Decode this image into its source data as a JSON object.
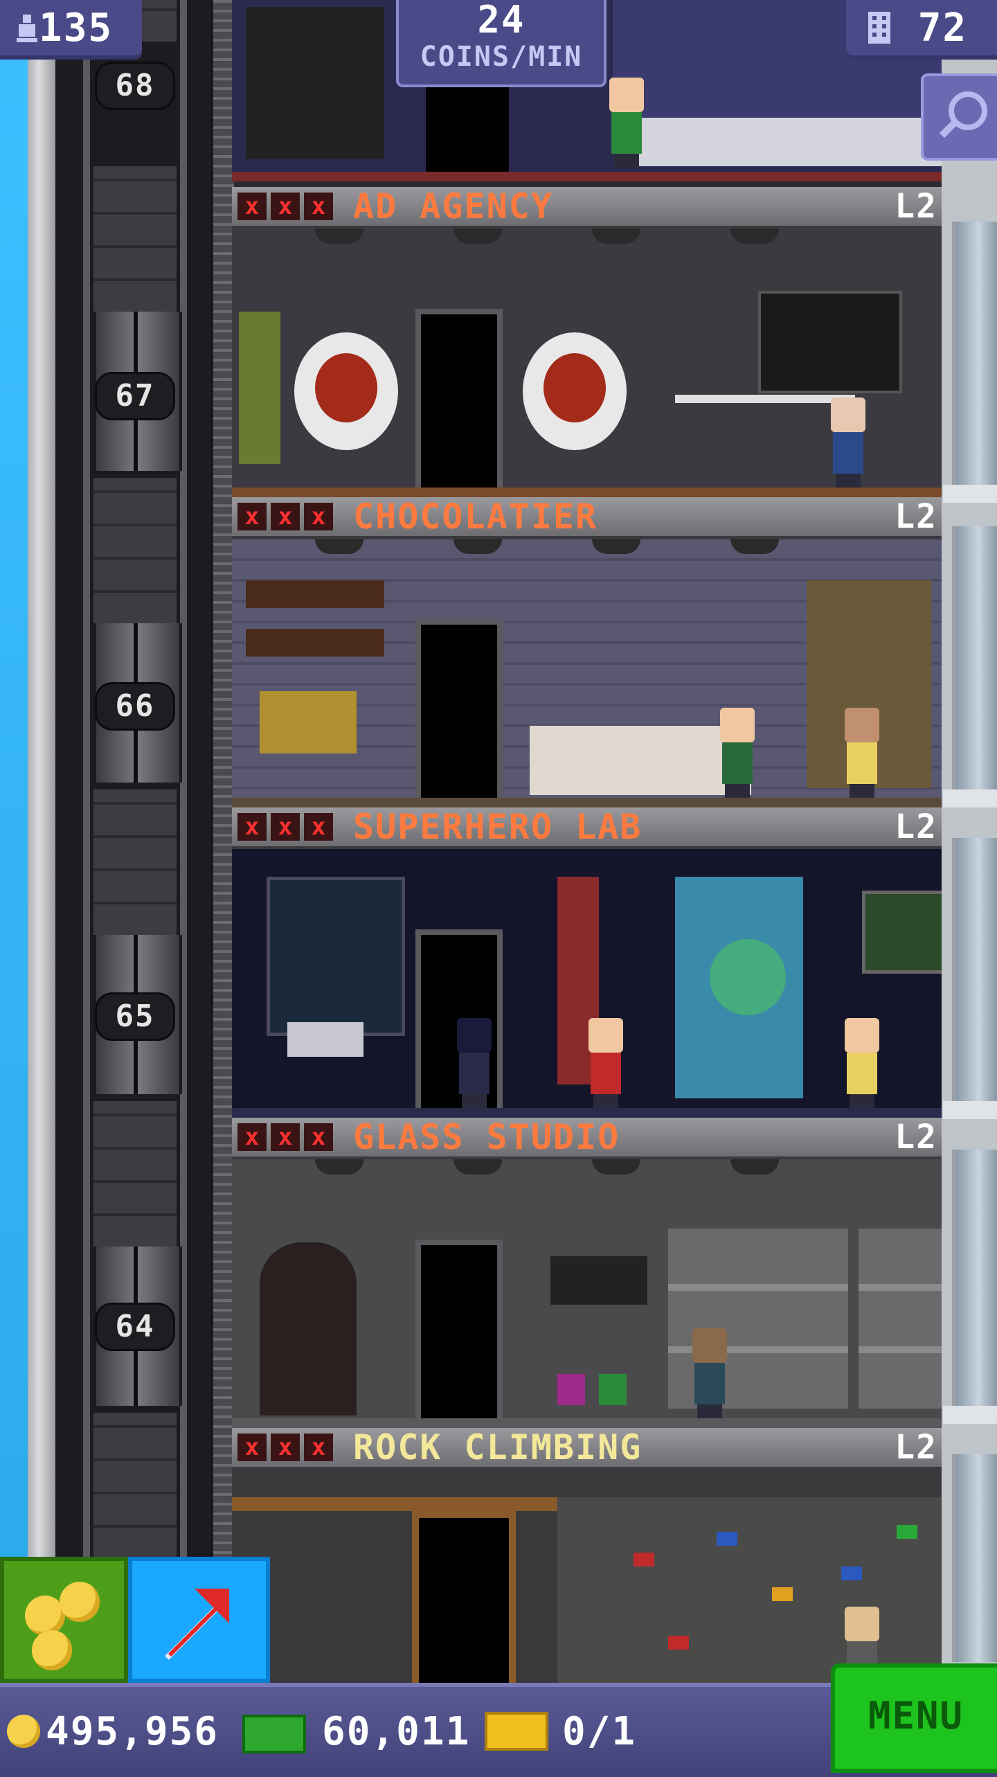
{
  "hud": {
    "population": "135",
    "coins_per_min_value": "24",
    "coins_per_min_label": "COINS/MIN",
    "floors": "72"
  },
  "shaft": {
    "floor_numbers": [
      "68",
      "67",
      "66",
      "65",
      "64"
    ]
  },
  "floors": [
    {
      "name": "AD AGENCY",
      "level": "L2",
      "marks": [
        "x",
        "x",
        "x"
      ]
    },
    {
      "name": "CHOCOLATIER",
      "level": "L2",
      "marks": [
        "x",
        "x",
        "x"
      ]
    },
    {
      "name": "SUPERHERO LAB",
      "level": "L2",
      "marks": [
        "x",
        "x",
        "x"
      ]
    },
    {
      "name": "GLASS STUDIO",
      "level": "L2",
      "marks": [
        "x",
        "x",
        "x"
      ]
    },
    {
      "name": "ROCK CLIMBING",
      "level": "L2",
      "marks": [
        "x",
        "x",
        "x"
      ]
    }
  ],
  "bottom": {
    "coins": "495,956",
    "bux": "60,011",
    "tickets": "0/1",
    "menu_label": "MENU"
  },
  "colors": {
    "floor_name_orange": "#ff7a3e",
    "floor_name_gold": "#f3e79a",
    "hud_purple": "#4a4a88",
    "menu_green": "#1ec41e",
    "elevator_blue": "#1aa8ff"
  },
  "icons": {
    "population": "person-up-icon",
    "floors": "building-icon",
    "search": "magnifier-icon",
    "coins": "coin-icon",
    "bux": "bux-bill-icon",
    "tickets": "golden-ticket-icon",
    "elevator": "red-arrow-icon",
    "mark": "x-mark-icon"
  }
}
